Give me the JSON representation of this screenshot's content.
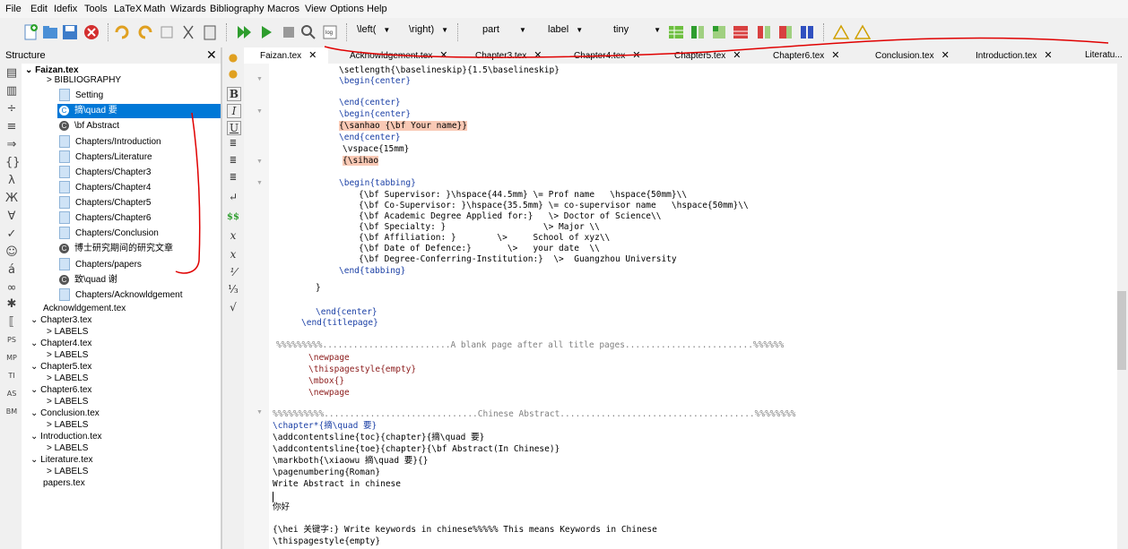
{
  "menu": [
    "File",
    "Edit",
    "Idefix",
    "Tools",
    "LaTeX",
    "Math",
    "Wizards",
    "Bibliography",
    "Macros",
    "View",
    "Options",
    "Help"
  ],
  "toolbar": {
    "combo_left": "\\left(",
    "combo_right": "\\right)",
    "combo_part": "part",
    "combo_label": "label",
    "combo_size": "tiny"
  },
  "structure": {
    "title": "Structure",
    "root": "Faizan.tex",
    "items": [
      "BIBLIOGRAPHY",
      "Setting",
      "摘\\quad 要",
      "\\bf Abstract",
      "Chapters/Introduction",
      "Chapters/Literature",
      "Chapters/Chapter3",
      "Chapters/Chapter4",
      "Chapters/Chapter5",
      "Chapters/Chapter6",
      "Chapters/Conclusion",
      "博士研究期间的研究文章",
      "Chapters/papers",
      "致\\quad 谢",
      "Chapters/Acknowldgement"
    ],
    "files": [
      "Acknowldgement.tex",
      "Chapter3.tex",
      "LABELS",
      "Chapter4.tex",
      "LABELS",
      "Chapter5.tex",
      "LABELS",
      "Chapter6.tex",
      "LABELS",
      "Conclusion.tex",
      "LABELS",
      "Introduction.tex",
      "LABELS",
      "Literature.tex",
      "LABELS",
      "papers.tex"
    ]
  },
  "tabs": [
    "Faizan.tex",
    "Acknowldgement.tex",
    "Chapter3.tex",
    "Chapter4.tex",
    "Chapter5.tex",
    "Chapter6.tex",
    "Conclusion.tex",
    "Introduction.tex",
    "Literatu..."
  ],
  "code": [
    "\\setlength{\\baselineskip}{1.5\\baselineskip}",
    "\\begin{center}",
    "",
    "\\end{center}",
    "\\begin{center}",
    "{\\sanhao {\\bf Your name}}",
    "\\end{center}",
    "\\vspace{15mm}",
    "{\\sihao",
    "",
    "\\begin{tabbing}",
    "{\\bf Supervisor: }\\hspace{44.5mm} \\= Prof name   \\hspace{50mm}\\\\",
    "{\\bf Co-Supervisor: }\\hspace{35.5mm} \\= co-supervisor name   \\hspace{50mm}\\\\",
    "{\\bf Academic Degree Applied for:}   \\> Doctor of Science\\\\",
    "{\\bf Specialty: }                   \\> Major \\\\",
    "{\\bf Affiliation: }        \\>     School of xyz\\\\",
    "{\\bf Date of Defence:}       \\>   your date  \\\\",
    "{\\bf Degree-Conferring-Institution:}  \\>  Guangzhou University",
    "\\end{tabbing}",
    "}",
    "",
    "\\end{center}",
    "\\end{titlepage}",
    "",
    "%%%%%%%%%.........................A blank page after all title pages.........................%%%%%%",
    "\\newpage",
    "\\thispagestyle{empty}",
    "\\mbox{}",
    "\\newpage",
    "",
    "%%%%%%%%%%..............................Chinese Abstract......................................%%%%%%%%",
    "\\chapter*{摘\\quad 要}",
    "\\addcontentsline{toc}{chapter}{摘\\quad 要}",
    "\\addcontentsline{toe}{chapter}{\\bf Abstract(In Chinese)}",
    "\\markboth{\\xiaowu 摘\\quad 要}{}",
    "\\pagenumbering{Roman}",
    "Write Abstract in chinese",
    "",
    "你好",
    "",
    "{\\hei 关键字:} Write keywords in chinese%%%%% This means Keywords in Chinese",
    "\\thispagestyle{empty}"
  ],
  "colors": {
    "selection": "#0078d7",
    "keyword": "#1a3fa5",
    "highlight": "#f9c9b5",
    "annotation": "#e00000"
  }
}
